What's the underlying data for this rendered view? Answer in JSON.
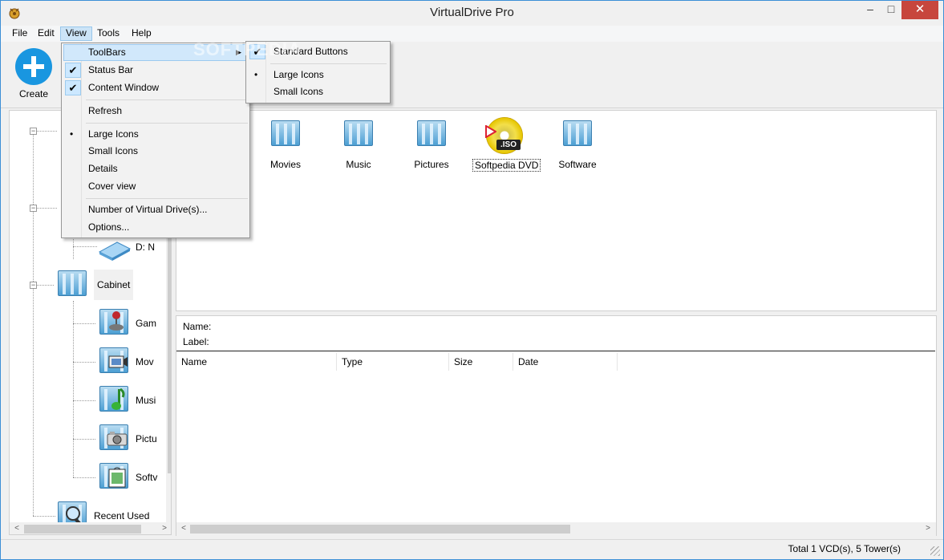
{
  "window": {
    "title": "VirtualDrive Pro",
    "min_glyph": "–",
    "max_glyph": "□",
    "close_glyph": "✕"
  },
  "menubar": {
    "items": [
      "File",
      "Edit",
      "View",
      "Tools",
      "Help"
    ]
  },
  "toolbar": {
    "create_label": "Create"
  },
  "view_menu": {
    "toolbars": "ToolBars",
    "status_bar": "Status Bar",
    "content_window": "Content Window",
    "refresh": "Refresh",
    "large_icons": "Large Icons",
    "small_icons": "Small Icons",
    "details": "Details",
    "cover_view": "Cover view",
    "number_of_drives": "Number of Virtual Drive(s)...",
    "options": "Options...",
    "check_glyph": "✔",
    "bullet_glyph": "•",
    "submenu_arrow": "▶"
  },
  "toolbars_submenu": {
    "standard_buttons": "Standard Buttons",
    "large_icons": "Large Icons",
    "small_icons": "Small Icons"
  },
  "tree": {
    "drive_d": "D: N",
    "cabinet": "Cabinet",
    "children": [
      "Gam",
      "Mov",
      "Musi",
      "Pictu",
      "Softv"
    ],
    "recent_used": "Recent Used",
    "expander_glyph": "−",
    "scroll_down_glyph": "∨",
    "scroll_left_glyph": "<",
    "scroll_right_glyph": ">"
  },
  "content": {
    "items": [
      "Movies",
      "Music",
      "Pictures",
      "Softpedia DVD",
      "Software"
    ],
    "selected_item": "Softpedia DVD",
    "iso_badge": ".ISO"
  },
  "details": {
    "name_label": "Name:",
    "label_label": "Label:",
    "columns": [
      "Name",
      "Type",
      "Size",
      "Date"
    ]
  },
  "statusbar": {
    "text": "Total 1 VCD(s), 5 Tower(s)"
  },
  "watermark": "SOFTPEDIA",
  "colors": {
    "accent": "#1996e0",
    "close_button": "#c7463d",
    "menu_highlight": "#cce4f7",
    "folder_blue": "#4c9fd3"
  }
}
